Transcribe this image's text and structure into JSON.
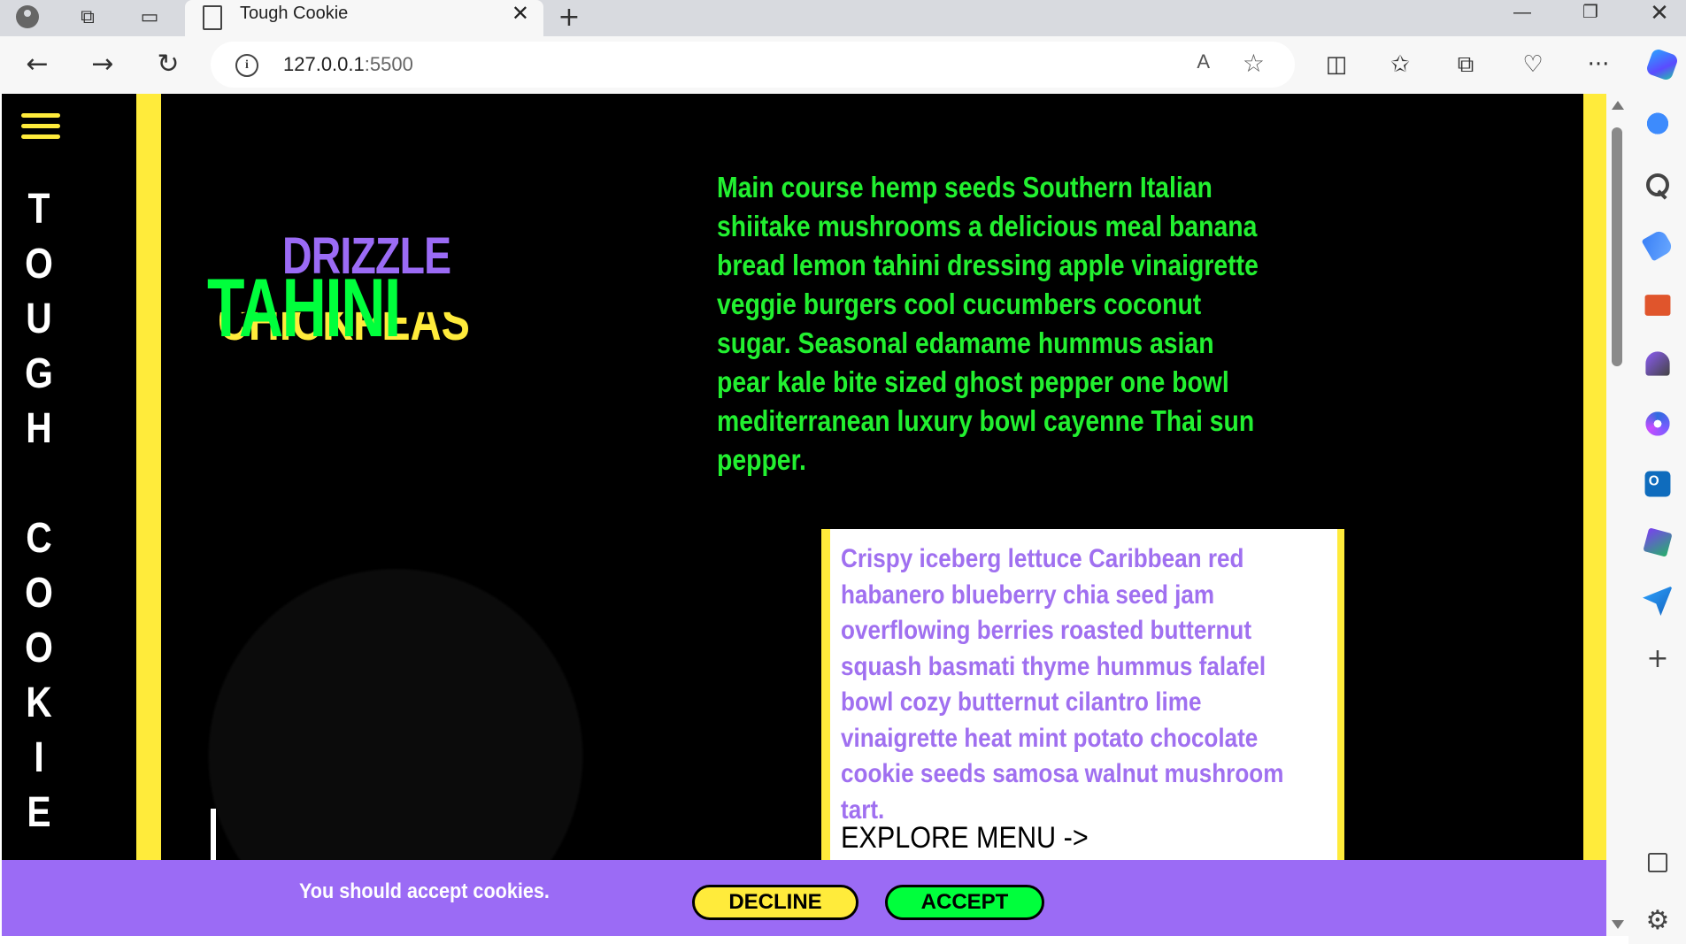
{
  "browser": {
    "tab_title": "Tough Cookie",
    "tab_close": "✕",
    "new_tab": "+",
    "url_host": "127.0.0.1",
    "url_port": ":5500",
    "read_aloud": "A",
    "favorite": "☆",
    "minimize": "—",
    "maximize": "❐",
    "close": "✕",
    "back": "←",
    "forward": "→",
    "reload": "↻",
    "more": "···",
    "add": "+",
    "settings": "⚙"
  },
  "site": {
    "brand_letters": [
      "T",
      "O",
      "U",
      "G",
      "H",
      "",
      "C",
      "O",
      "O",
      "K",
      "I",
      "E"
    ],
    "hero_words": {
      "top": "DRIZZLE",
      "middle": "TAHINI",
      "bottom": "CHICKPEAS"
    },
    "intro_paragraph": "Main course hemp seeds Southern Italian shiitake mushrooms a delicious meal banana bread lemon tahini dressing apple vinaigrette veggie burgers cool cucumbers coconut sugar. Seasonal edamame hummus asian pear kale bite sized ghost pepper one bowl mediterranean luxury bowl cayenne Thai sun pepper.",
    "card_text": "Crispy iceberg lettuce Caribbean red habanero blueberry chia seed jam overflowing berries roasted butternut squash basmati thyme hummus falafel bowl cozy butternut cilantro lime vinaigrette heat mint potato chocolate cookie seeds samosa walnut mushroom tart.",
    "explore_link": "EXPLORE MENU ->"
  },
  "cookie_banner": {
    "message": "You should accept cookies.",
    "decline": "DECLINE",
    "accept": "ACCEPT"
  },
  "colors": {
    "yellow": "#ffeb3b",
    "green": "#22f030",
    "purple": "#9b6bf5",
    "black": "#000000"
  }
}
